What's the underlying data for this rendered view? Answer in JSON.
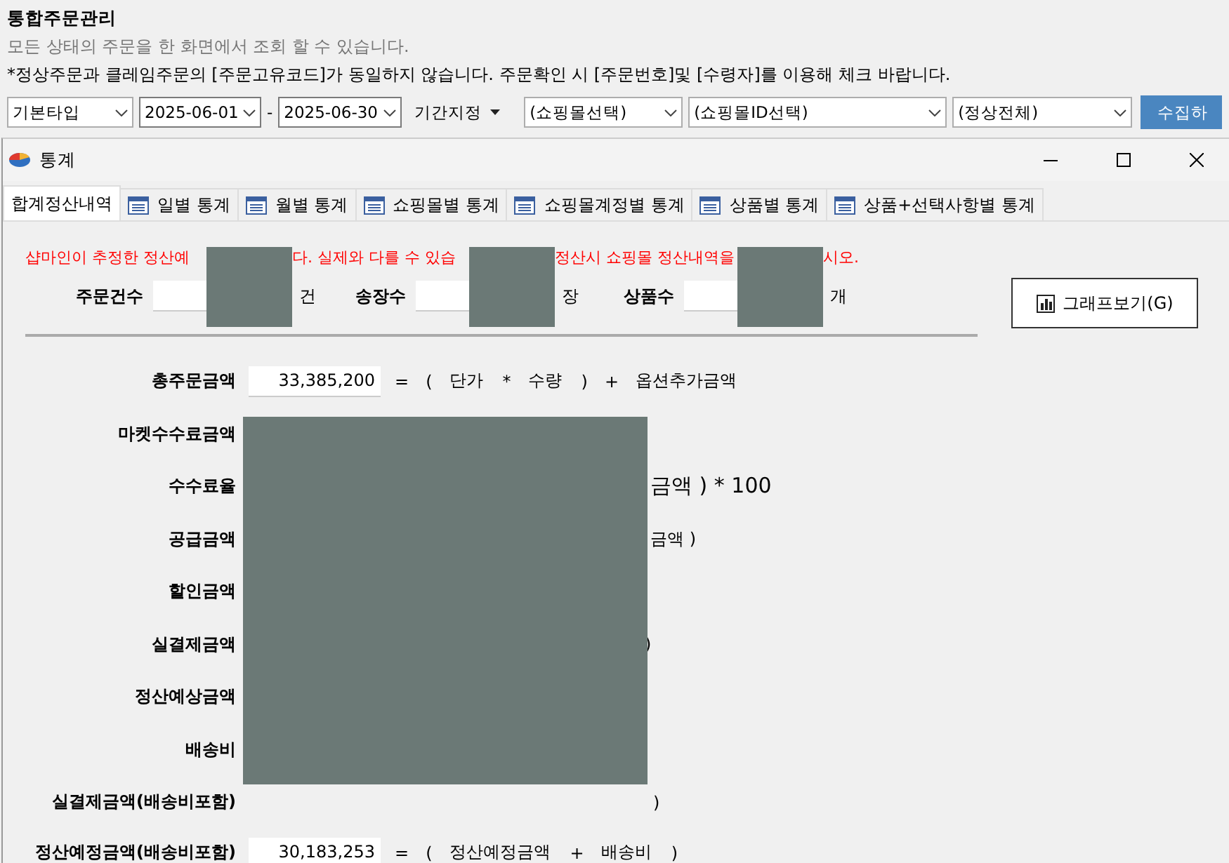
{
  "header": {
    "title": "통합주문관리",
    "description": "모든 상태의 주문을 한 화면에서 조회 할 수 있습니다.",
    "notice": "*정상주문과 클레임주문의 [주문고유코드]가 동일하지 않습니다. 주문확인 시 [주문번호]및 [수령자]를 이용해 체크 바랍니다."
  },
  "filters": [
    {
      "kind": "select",
      "value": "기본타입"
    },
    {
      "kind": "date",
      "value": "2025-06-01"
    },
    {
      "kind": "separator",
      "value": "-"
    },
    {
      "kind": "date",
      "value": "2025-06-30"
    },
    {
      "kind": "menu",
      "value": "기간지정"
    },
    {
      "kind": "select",
      "value": "(쇼핑몰선택)"
    },
    {
      "kind": "select",
      "value": "(쇼핑몰ID선택)"
    },
    {
      "kind": "select",
      "value": "(정상전체)"
    },
    {
      "kind": "button",
      "value": "수집하"
    }
  ],
  "window": {
    "title": "통계",
    "tabs": [
      {
        "label": "합계정산내역",
        "selected": true,
        "icon": false
      },
      {
        "label": "일별 통계",
        "selected": false,
        "icon": true
      },
      {
        "label": "월별 통계",
        "selected": false,
        "icon": true
      },
      {
        "label": "쇼핑몰별 통계",
        "selected": false,
        "icon": true
      },
      {
        "label": "쇼핑몰계정별 통계",
        "selected": false,
        "icon": true
      },
      {
        "label": "상품별 통계",
        "selected": false,
        "icon": true
      },
      {
        "label": "상품+선택사항별 통계",
        "selected": false,
        "icon": true
      }
    ],
    "warning_segments": [
      "샵마인이 추정한 정산예",
      "다. 실제와 다를 수 있습",
      "정산시 쇼핑몰 정산내역을",
      "시오."
    ],
    "counts": [
      {
        "label": "주문건수",
        "unit": "건"
      },
      {
        "label": "송장수",
        "unit": "장"
      },
      {
        "label": "상품수",
        "unit": "개"
      }
    ],
    "graph_button": "그래프보기(G)",
    "rows": [
      {
        "label": "총주문금액",
        "value": "33,385,200",
        "formula": [
          "=",
          "(",
          "단가",
          "*",
          "수량",
          ")",
          "+",
          "옵션추가금액"
        ]
      },
      {
        "label": "마켓수수료금액"
      },
      {
        "label": "수수료율",
        "formula_tail": "금액 ) * 100"
      },
      {
        "label": "공급금액",
        "formula_tail": "금액 )"
      },
      {
        "label": "할인금액"
      },
      {
        "label": "실결제금액",
        "formula_tail": ")"
      },
      {
        "label": "정산예상금액"
      },
      {
        "label": "배송비"
      },
      {
        "label": "실결제금액(배송비포함)",
        "formula_tail": ")"
      },
      {
        "label": "정산예정금액(배송비포함)",
        "value": "30,183,253",
        "formula": [
          "=",
          "(",
          "정산예정금액",
          "+",
          "배송비",
          ")"
        ]
      }
    ]
  }
}
